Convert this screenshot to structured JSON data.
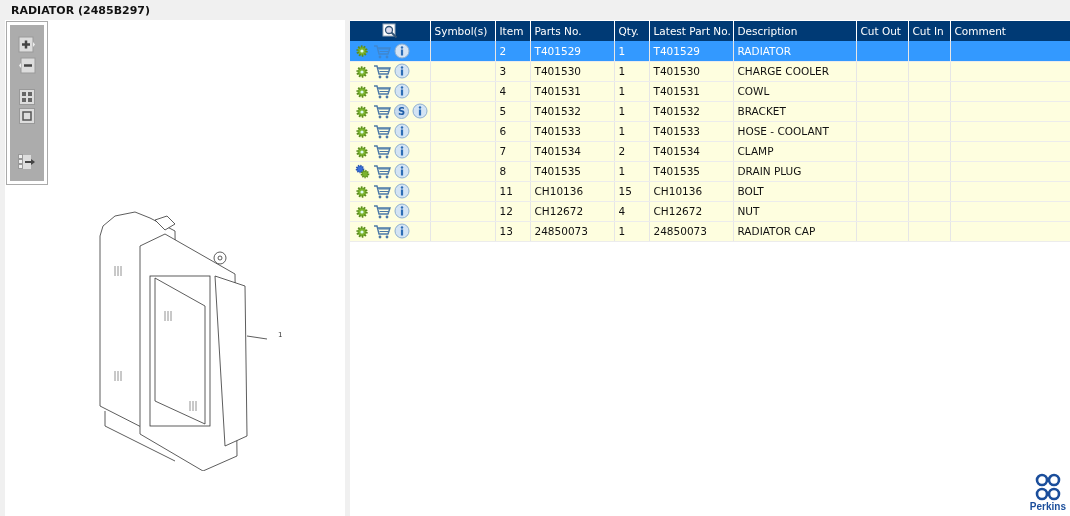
{
  "title": "RADIATOR (2485B297)",
  "viewer": {
    "callout": "1"
  },
  "table": {
    "columns": [
      "Symbol(s)",
      "Item",
      "Parts No.",
      "Qty.",
      "Latest Part No.",
      "Description",
      "Cut Out",
      "Cut In",
      "Comment"
    ],
    "rows": [
      {
        "selected": true,
        "kind": "single",
        "badge": null,
        "cells": [
          "",
          "2",
          "T401529",
          "1",
          "T401529",
          "RADIATOR",
          "",
          "",
          ""
        ]
      },
      {
        "selected": false,
        "kind": "single",
        "badge": null,
        "cells": [
          "",
          "3",
          "T401530",
          "1",
          "T401530",
          "CHARGE COOLER",
          "",
          "",
          ""
        ]
      },
      {
        "selected": false,
        "kind": "single",
        "badge": null,
        "cells": [
          "",
          "4",
          "T401531",
          "1",
          "T401531",
          "COWL",
          "",
          "",
          ""
        ]
      },
      {
        "selected": false,
        "kind": "single",
        "badge": "S",
        "cells": [
          "",
          "5",
          "T401532",
          "1",
          "T401532",
          "BRACKET",
          "",
          "",
          ""
        ]
      },
      {
        "selected": false,
        "kind": "single",
        "badge": null,
        "cells": [
          "",
          "6",
          "T401533",
          "1",
          "T401533",
          "HOSE - COOLANT",
          "",
          "",
          ""
        ]
      },
      {
        "selected": false,
        "kind": "single",
        "badge": null,
        "cells": [
          "",
          "7",
          "T401534",
          "2",
          "T401534",
          "CLAMP",
          "",
          "",
          ""
        ]
      },
      {
        "selected": false,
        "kind": "pair",
        "badge": null,
        "cells": [
          "",
          "8",
          "T401535",
          "1",
          "T401535",
          "DRAIN PLUG",
          "",
          "",
          ""
        ]
      },
      {
        "selected": false,
        "kind": "single",
        "badge": null,
        "cells": [
          "",
          "11",
          "CH10136",
          "15",
          "CH10136",
          "BOLT",
          "",
          "",
          ""
        ]
      },
      {
        "selected": false,
        "kind": "single",
        "badge": null,
        "cells": [
          "",
          "12",
          "CH12672",
          "4",
          "CH12672",
          "NUT",
          "",
          "",
          ""
        ]
      },
      {
        "selected": false,
        "kind": "single",
        "badge": null,
        "cells": [
          "",
          "13",
          "24850073",
          "1",
          "24850073",
          "RADIATOR CAP",
          "",
          "",
          ""
        ]
      }
    ]
  },
  "brand": "Perkins"
}
